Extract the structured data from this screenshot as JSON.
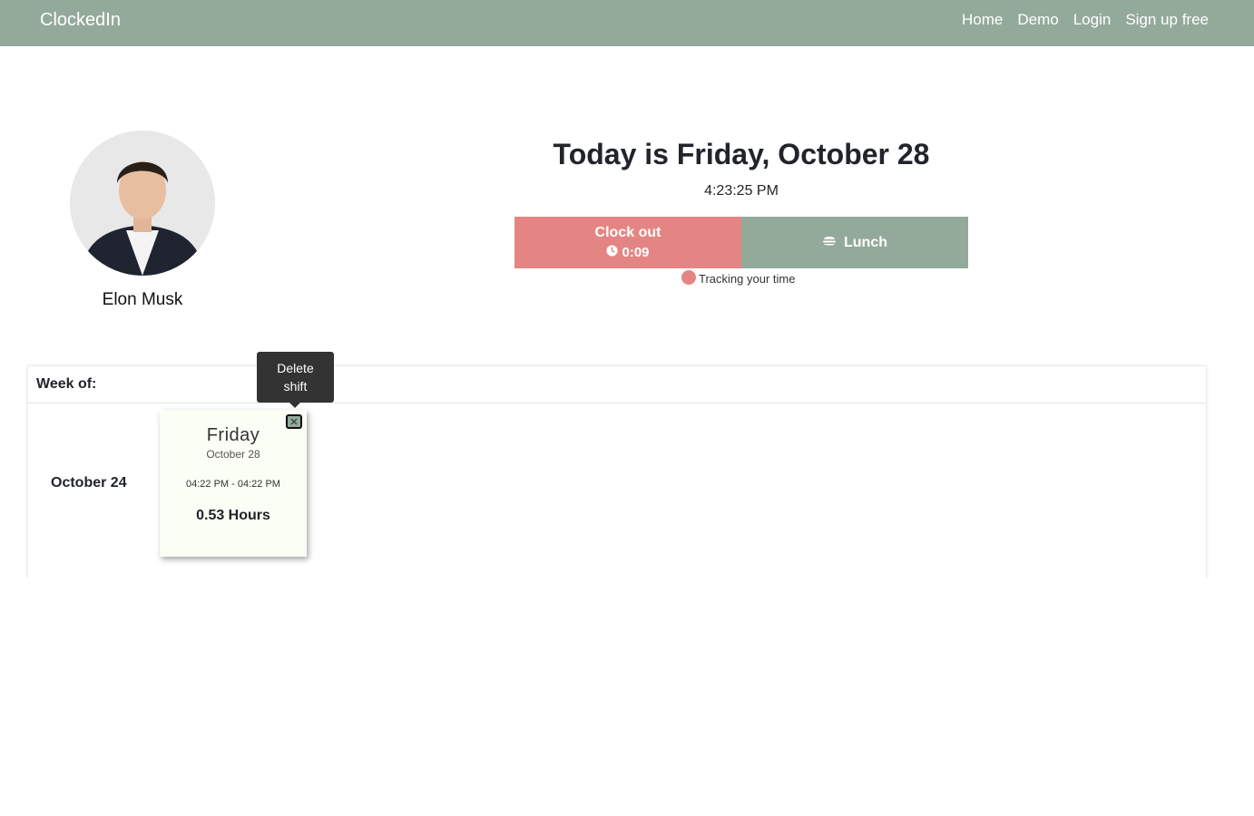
{
  "nav": {
    "brand": "ClockedIn",
    "links": [
      "Home",
      "Demo",
      "Login",
      "Sign up free"
    ]
  },
  "profile": {
    "name": "Elon Musk"
  },
  "today": {
    "title": "Today is Friday, October 28",
    "time": "4:23:25 PM"
  },
  "actions": {
    "clock_out_label": "Clock out",
    "clock_out_elapsed": "0:09",
    "lunch_label": "Lunch",
    "tracking_text": "Tracking your time"
  },
  "week": {
    "header": "Week of:",
    "date_label": "October 24",
    "shift": {
      "day": "Friday",
      "date": "October 28",
      "range": "04:22 PM - 04:22 PM",
      "hours": "0.53 Hours"
    }
  },
  "tooltip": {
    "text_line1": "Delete",
    "text_line2": "shift"
  },
  "colors": {
    "navbar": "#93aa9b",
    "clock_out": "#e48584",
    "lunch": "#93aa9b",
    "shift_card": "#fbfef5"
  }
}
